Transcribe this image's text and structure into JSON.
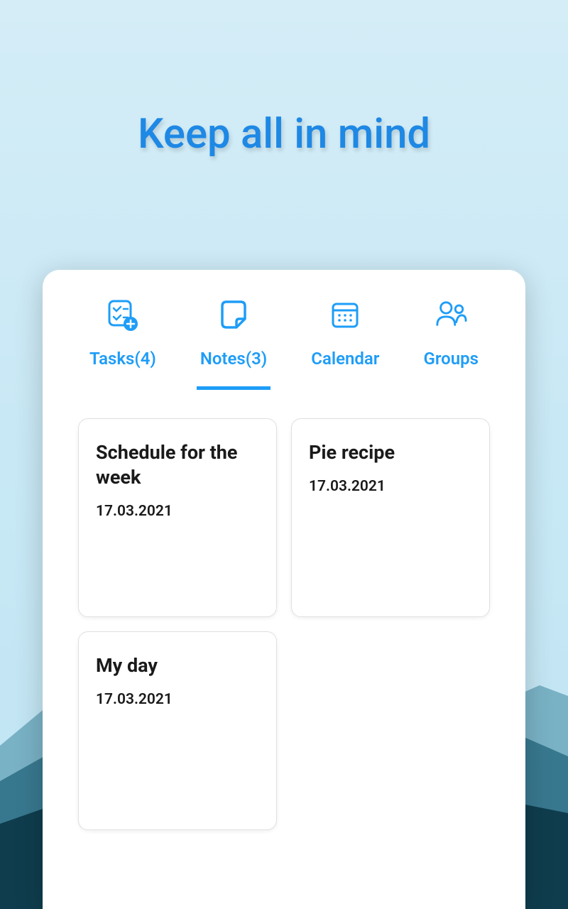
{
  "headline": "Keep all in mind",
  "tabs": [
    {
      "label": "Tasks(4)",
      "icon": "tasks"
    },
    {
      "label": "Notes(3)",
      "icon": "notes"
    },
    {
      "label": "Calendar",
      "icon": "calendar"
    },
    {
      "label": "Groups",
      "icon": "groups"
    }
  ],
  "active_tab": "Notes(3)",
  "notes": [
    {
      "title": "Schedule for the week",
      "date": "17.03.2021"
    },
    {
      "title": "Pie recipe",
      "date": "17.03.2021"
    },
    {
      "title": "My day",
      "date": "17.03.2021"
    }
  ],
  "colors": {
    "accent": "#1e9df7",
    "headline": "#1e88e5"
  }
}
